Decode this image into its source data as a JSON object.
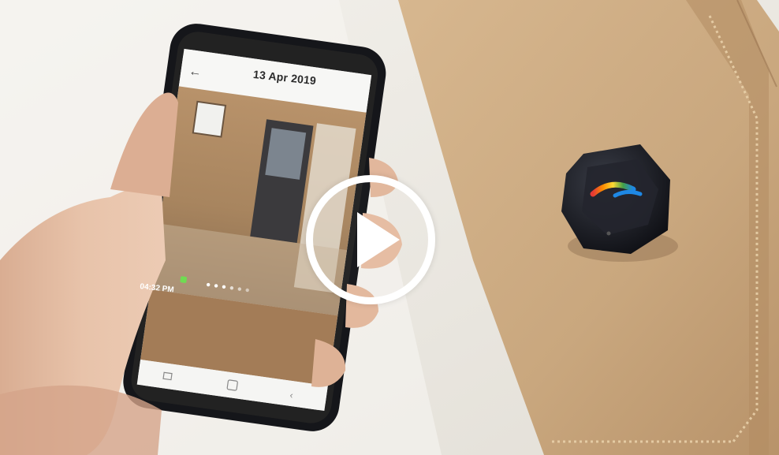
{
  "video": {
    "play_icon": "play-icon",
    "colors": {
      "background": "#ece9e3",
      "wallet": "#c9a77f",
      "device": "#1b1d24",
      "overlay": "#ffffff"
    }
  },
  "phone_screen": {
    "date_label": "13 Apr 2019",
    "time_label": "04:32 PM"
  }
}
